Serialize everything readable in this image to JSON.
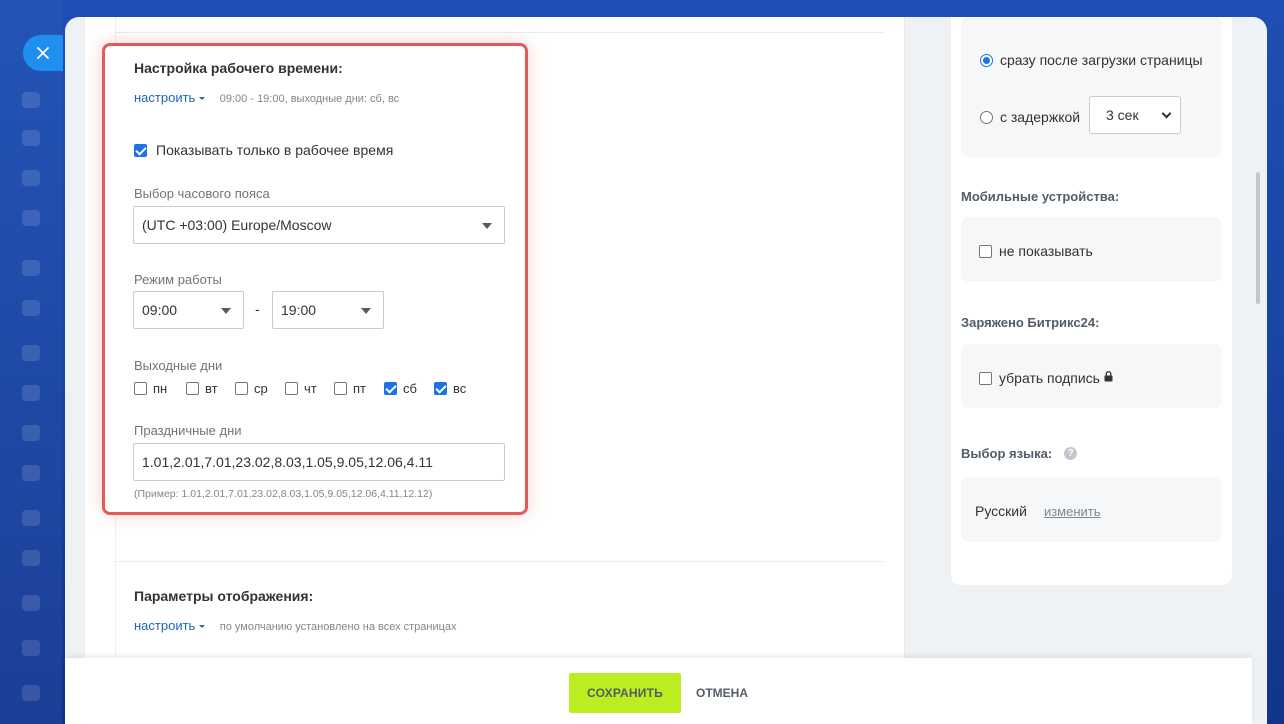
{
  "working_time": {
    "title": "Настройка рабочего времени:",
    "setup_link": "настроить",
    "summary": "09:00 - 19:00, выходные дни: сб, вс",
    "only_working_time_label": "Показывать только в рабочее время",
    "only_working_time_checked": true,
    "timezone_label": "Выбор часового пояса",
    "timezone_value": "(UTC +03:00) Europe/Moscow",
    "mode_label": "Режим работы",
    "start_time": "09:00",
    "time_separator": "-",
    "end_time": "19:00",
    "weekends_label": "Выходные дни",
    "days": [
      {
        "label": "пн",
        "checked": false
      },
      {
        "label": "вт",
        "checked": false
      },
      {
        "label": "ср",
        "checked": false
      },
      {
        "label": "чт",
        "checked": false
      },
      {
        "label": "пт",
        "checked": false
      },
      {
        "label": "сб",
        "checked": true
      },
      {
        "label": "вс",
        "checked": true
      }
    ],
    "holidays_label": "Праздничные дни",
    "holidays_value": "1.01,2.01,7.01,23.02,8.03,1.05,9.05,12.06,4.11",
    "holidays_example": "(Пример: 1.01,2.01,7.01,23.02,8.03,1.05,9.05,12.06,4.11,12.12)"
  },
  "display_params": {
    "title": "Параметры отображения:",
    "setup_link": "настроить",
    "summary": "по умолчанию установлено на всех страницах"
  },
  "sidebar": {
    "show_after_load_label": "сразу после загрузки страницы",
    "show_with_delay_label": "с задержкой",
    "delay_value": "3 сек",
    "mobile_title": "Мобильные устройства:",
    "mobile_hide_label": "не показывать",
    "bitrix_title": "Заряжено Битрикс24:",
    "remove_signature_label": "убрать подпись",
    "language_title": "Выбор языка:",
    "language_value": "Русский",
    "language_change_link": "изменить"
  },
  "footer": {
    "save_label": "СОХРАНИТЬ",
    "cancel_label": "ОТМЕНА"
  },
  "icons": {
    "close": "close-icon",
    "lock": "lock-icon",
    "help": "help-icon",
    "help_glyph": "?"
  },
  "colors": {
    "accent_blue": "#1a73e8",
    "save_green": "#bbed21",
    "highlight_red": "#e35a5a"
  }
}
